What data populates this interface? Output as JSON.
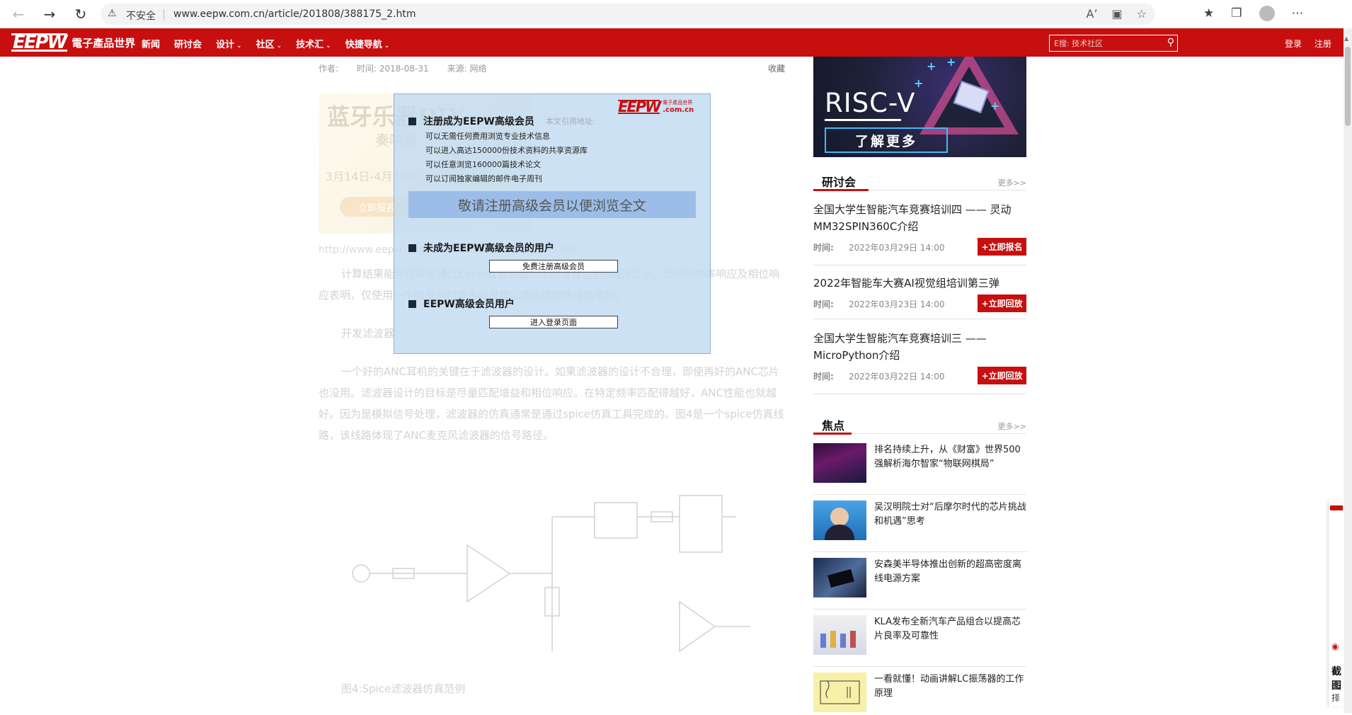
{
  "browser": {
    "insecure_label": "不安全",
    "url": "www.eepw.com.cn/article/201808/388175_2.htm"
  },
  "site": {
    "logo_text": "EEPW",
    "logo_cn": "電子產品世界",
    "nav": [
      "新闻",
      "研讨会",
      "设计",
      "社区",
      "技术汇",
      "快捷导航"
    ],
    "nav_has_dropdown": [
      false,
      false,
      true,
      true,
      true,
      true
    ],
    "search_placeholder": "E搜: 技术社区",
    "login": "登录",
    "register": "注册"
  },
  "article": {
    "author_label": "作者:",
    "time": "时间: 2018-08-31",
    "source": "来源: 网络",
    "favorite": "收藏",
    "banner": {
      "line1": "蓝牙乐器DIY",
      "line2": "奏响春",
      "line3": "3月14日-4月30日",
      "button": "立即报名"
    },
    "cite_link": "http://www.eepw.com.cn/article/201808/388175.htm",
    "para1": "计算结果能够很容易通过Excel表格做出一个滤波器范例如图6显示。范例的频率响应及相位响应表明，仅使用一个简单的相放大器是难以做出理想降噪信号的。",
    "heading": "开发滤波器",
    "para2": "一个好的ANC耳机的关键在于滤波器的设计。如果滤波器的设计不合理，即使再好的ANC芯片也没用。滤波器设计的目标是尽量匹配增益和相位响应。在特定频率匹配得越好，ANC性能也就越好。因为是模拟信号处理，滤波器的仿真通常是通过spice仿真工具完成的。图4是一个spice仿真线路，该线路体现了ANC麦克风滤波器的信号路径。",
    "figure_caption": "图4:Spice滤波器仿真范例"
  },
  "modal": {
    "logo_text": "EEPW",
    "logo_cn": "電子產品世界",
    "logo_domain": ".com.cn",
    "cite_hint": "本文引用地址:",
    "section1_title": "注册成为EEPW高级会员",
    "benefits": [
      "可以无需任何费用浏览专业技术信息",
      "可以进入高达150000份技术资料的共享资源库",
      "可以任意浏览160000篇技术论文",
      "可以订阅独家编辑的邮件电子周刊"
    ],
    "notice": "敬请注册高级会员以便浏览全文",
    "section2_title": "未成为EEPW高级会员的用户",
    "register_button": "免费注册高级会员",
    "section3_title": "EEPW高级会员用户",
    "login_button": "进入登录页面"
  },
  "sidebar": {
    "ad": {
      "title": "RISC-V",
      "button": "了解更多"
    },
    "seminars_title": "研讨会",
    "more": "更多>>",
    "time_label": "时间:",
    "seminars": [
      {
        "title": "全国大学生智能汽车竞赛培训四 —— 灵动MM32SPIN360C介绍",
        "time": "2022年03月29日 14:00",
        "action": "+立即报名"
      },
      {
        "title": "2022年智能车大赛AI视觉组培训第三弹",
        "time": "2022年03月23日 14:00",
        "action": "+立即回放"
      },
      {
        "title": "全国大学生智能汽车竞赛培训三 —— MicroPython介绍",
        "time": "2022年03月22日 14:00",
        "action": "+立即回放"
      }
    ],
    "focus_title": "焦点",
    "focus": [
      {
        "title": "排名持续上升，从《财富》世界500强解析海尔智家“物联网棋局”"
      },
      {
        "title": "吴汉明院士对“后摩尔时代的芯片挑战和机遇”思考"
      },
      {
        "title": "安森美半导体推出创新的超高密度离线电源方案"
      },
      {
        "title": "KLA发布全新汽车产品组合以提高芯片良率及可靠性"
      },
      {
        "title": "一看就懂！动画讲解LC振荡器的工作原理"
      }
    ]
  },
  "float_widget": {
    "title": "截图",
    "subtitle": "选择"
  },
  "colors": {
    "brand_red": "#c70f0f",
    "modal_bg": "#c1dbf0",
    "notice_band": "#9bbde8",
    "ad_accent": "#47b7f5"
  }
}
